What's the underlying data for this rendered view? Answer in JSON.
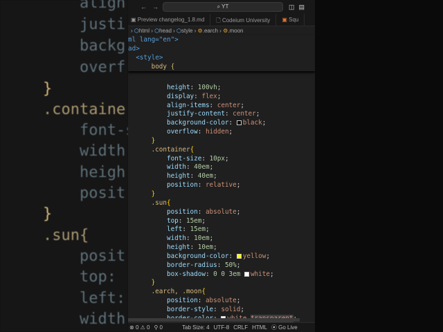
{
  "background_code": [
    "align",
    "justi",
    "backg",
    "overf",
    "}",
    ".containe",
    "font-s",
    "width",
    "heigh",
    "posit",
    "}",
    ".sun{",
    "posit",
    "top: ",
    "left:",
    "width"
  ],
  "titlebar": {
    "search": "YT"
  },
  "tabs": [
    "Preview changelog_1.8.md",
    "Codeium University",
    "Squ"
  ],
  "breadcrumb": [
    "html",
    "head",
    "style",
    ".earch",
    ".moon"
  ],
  "sticky": [
    "ml lang=\"en\">",
    "ad>",
    "<style>",
    "body {"
  ],
  "status": {
    "problems": "0 ⚠ 0",
    "ports": "0",
    "tab_size": "Tab Size: 4",
    "encoding": "UTF-8",
    "eol": "CRLF",
    "language": "HTML",
    "golive": "Go Live"
  },
  "colors": {
    "black": "#000000",
    "yellow": "#ffff00",
    "white": "#ffffff"
  }
}
